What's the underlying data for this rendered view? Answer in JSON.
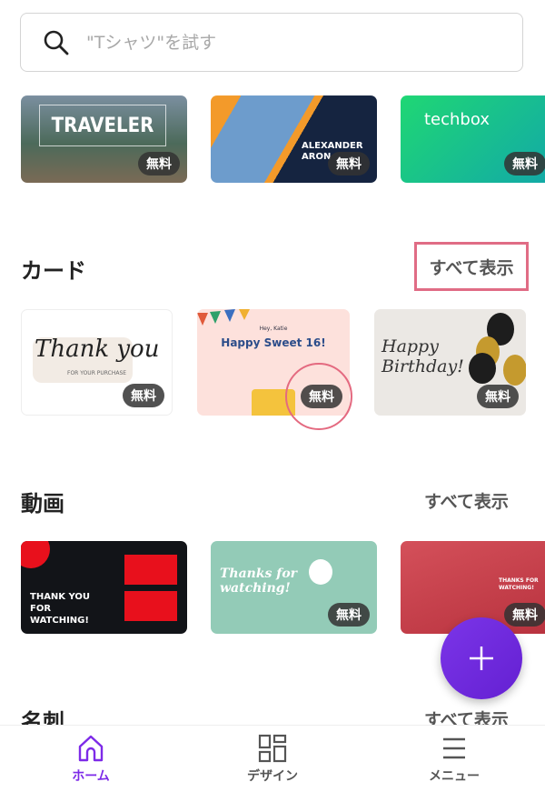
{
  "search": {
    "placeholder": "\"Tシャツ\"を試す",
    "icon": "search-icon"
  },
  "row1": [
    {
      "title": "TRAVELER",
      "badge": "無料"
    },
    {
      "title": "ALEXANDER ARON",
      "badge": "無料"
    },
    {
      "title": "techbox",
      "badge": "無料"
    }
  ],
  "cards": {
    "title": "カード",
    "see_all": "すべて表示",
    "items": [
      {
        "title": "Thank you",
        "subtitle": "FOR YOUR PURCHASE",
        "badge": "無料"
      },
      {
        "title": "Happy Sweet 16!",
        "subtitle": "Hey, Katie",
        "badge": "無料"
      },
      {
        "title": "Happy Birthday!",
        "badge": "無料"
      }
    ]
  },
  "videos": {
    "title": "動画",
    "see_all": "すべて表示",
    "items": [
      {
        "title": "THANK YOU FOR WATCHING!"
      },
      {
        "title": "Thanks for watching!",
        "badge": "無料"
      },
      {
        "title": "THANKS FOR WATCHING!",
        "badge": "無料"
      }
    ]
  },
  "business_cards": {
    "title": "名刺",
    "see_all": "すべて表示"
  },
  "fab": {
    "icon": "plus-icon"
  },
  "nav": [
    {
      "label": "ホーム",
      "icon": "home-icon",
      "active": true
    },
    {
      "label": "デザイン",
      "icon": "grid-icon"
    },
    {
      "label": "メニュー",
      "icon": "menu-icon"
    }
  ],
  "colors": {
    "accent": "#7d2ae8",
    "highlight": "#e06c85"
  }
}
